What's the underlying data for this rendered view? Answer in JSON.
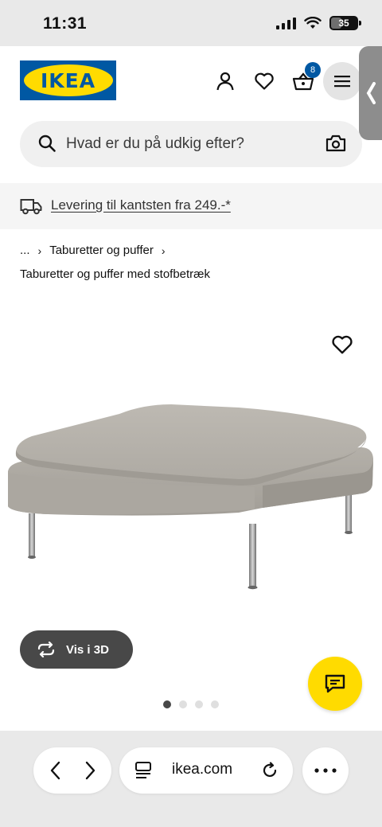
{
  "status": {
    "time": "11:31",
    "battery": "35"
  },
  "header": {
    "logo_text": "IKEA",
    "cart_count": "8"
  },
  "search": {
    "placeholder": "Hvad er du på udkig efter?"
  },
  "delivery": {
    "text": "Levering til kantsten fra 249.-*"
  },
  "breadcrumb": {
    "ellipsis": "...",
    "items": [
      "Taburetter og puffer"
    ]
  },
  "category_title": "Taburetter og puffer med stofbetræk",
  "product": {
    "view_3d_label": "Vis i 3D",
    "image_count": 4,
    "active_image": 1
  },
  "browser": {
    "url": "ikea.com"
  },
  "colors": {
    "ikea_blue": "#0058a3",
    "ikea_yellow": "#ffdb00",
    "dark_gray": "#484848"
  }
}
